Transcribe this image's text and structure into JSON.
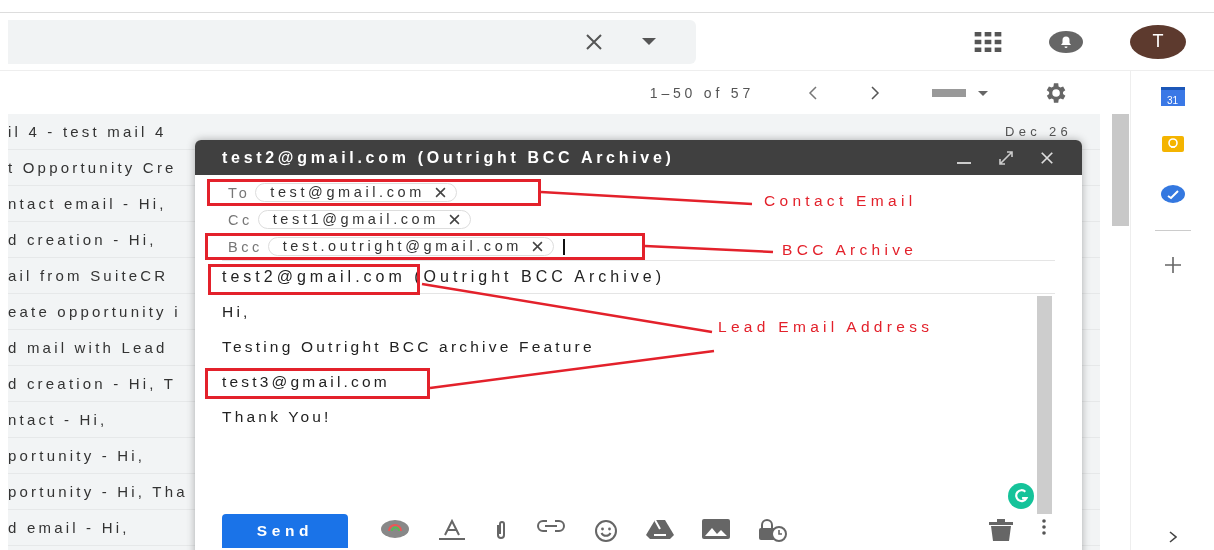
{
  "top_bar": {
    "avatar_letter": "T"
  },
  "toolbar": {
    "pagination": "1–50 of 57"
  },
  "side_panel": {
    "calendar_day": "31"
  },
  "email_rows": [
    {
      "text": "il 4 - test mail 4",
      "date": "Dec 26"
    },
    {
      "text": "t Opportunity Cre"
    },
    {
      "text": "ntact email - Hi,"
    },
    {
      "text": "d creation - Hi,"
    },
    {
      "text": "ail from SuiteCR"
    },
    {
      "text": "eate opportunity i"
    },
    {
      "text": "d mail with Lead"
    },
    {
      "text": "d creation - Hi, T"
    },
    {
      "text": "ntact - Hi,"
    },
    {
      "text": "portunity - Hi,"
    },
    {
      "text": "portunity - Hi, Tha"
    },
    {
      "text": "d email - Hi,"
    }
  ],
  "compose": {
    "title": "test2@gmail.com (Outright BCC Archive)",
    "recipients": [
      {
        "label": "To",
        "chips": [
          "test@gmail.com"
        ]
      },
      {
        "label": "Cc",
        "chips": [
          "test1@gmail.com"
        ]
      },
      {
        "label": "Bcc",
        "chips": [
          "test.outright@gmail.com"
        ]
      }
    ],
    "subject": "test2@gmail.com (Outright BCC Archive)",
    "body": [
      "Hi,",
      "Testing Outright BCC archive Feature",
      "test3@gmail.com",
      "Thank You!"
    ],
    "send": "Send"
  },
  "annotations": [
    {
      "label": "Contact Email"
    },
    {
      "label": "BCC Archive"
    },
    {
      "label": "Lead Email Address"
    }
  ]
}
